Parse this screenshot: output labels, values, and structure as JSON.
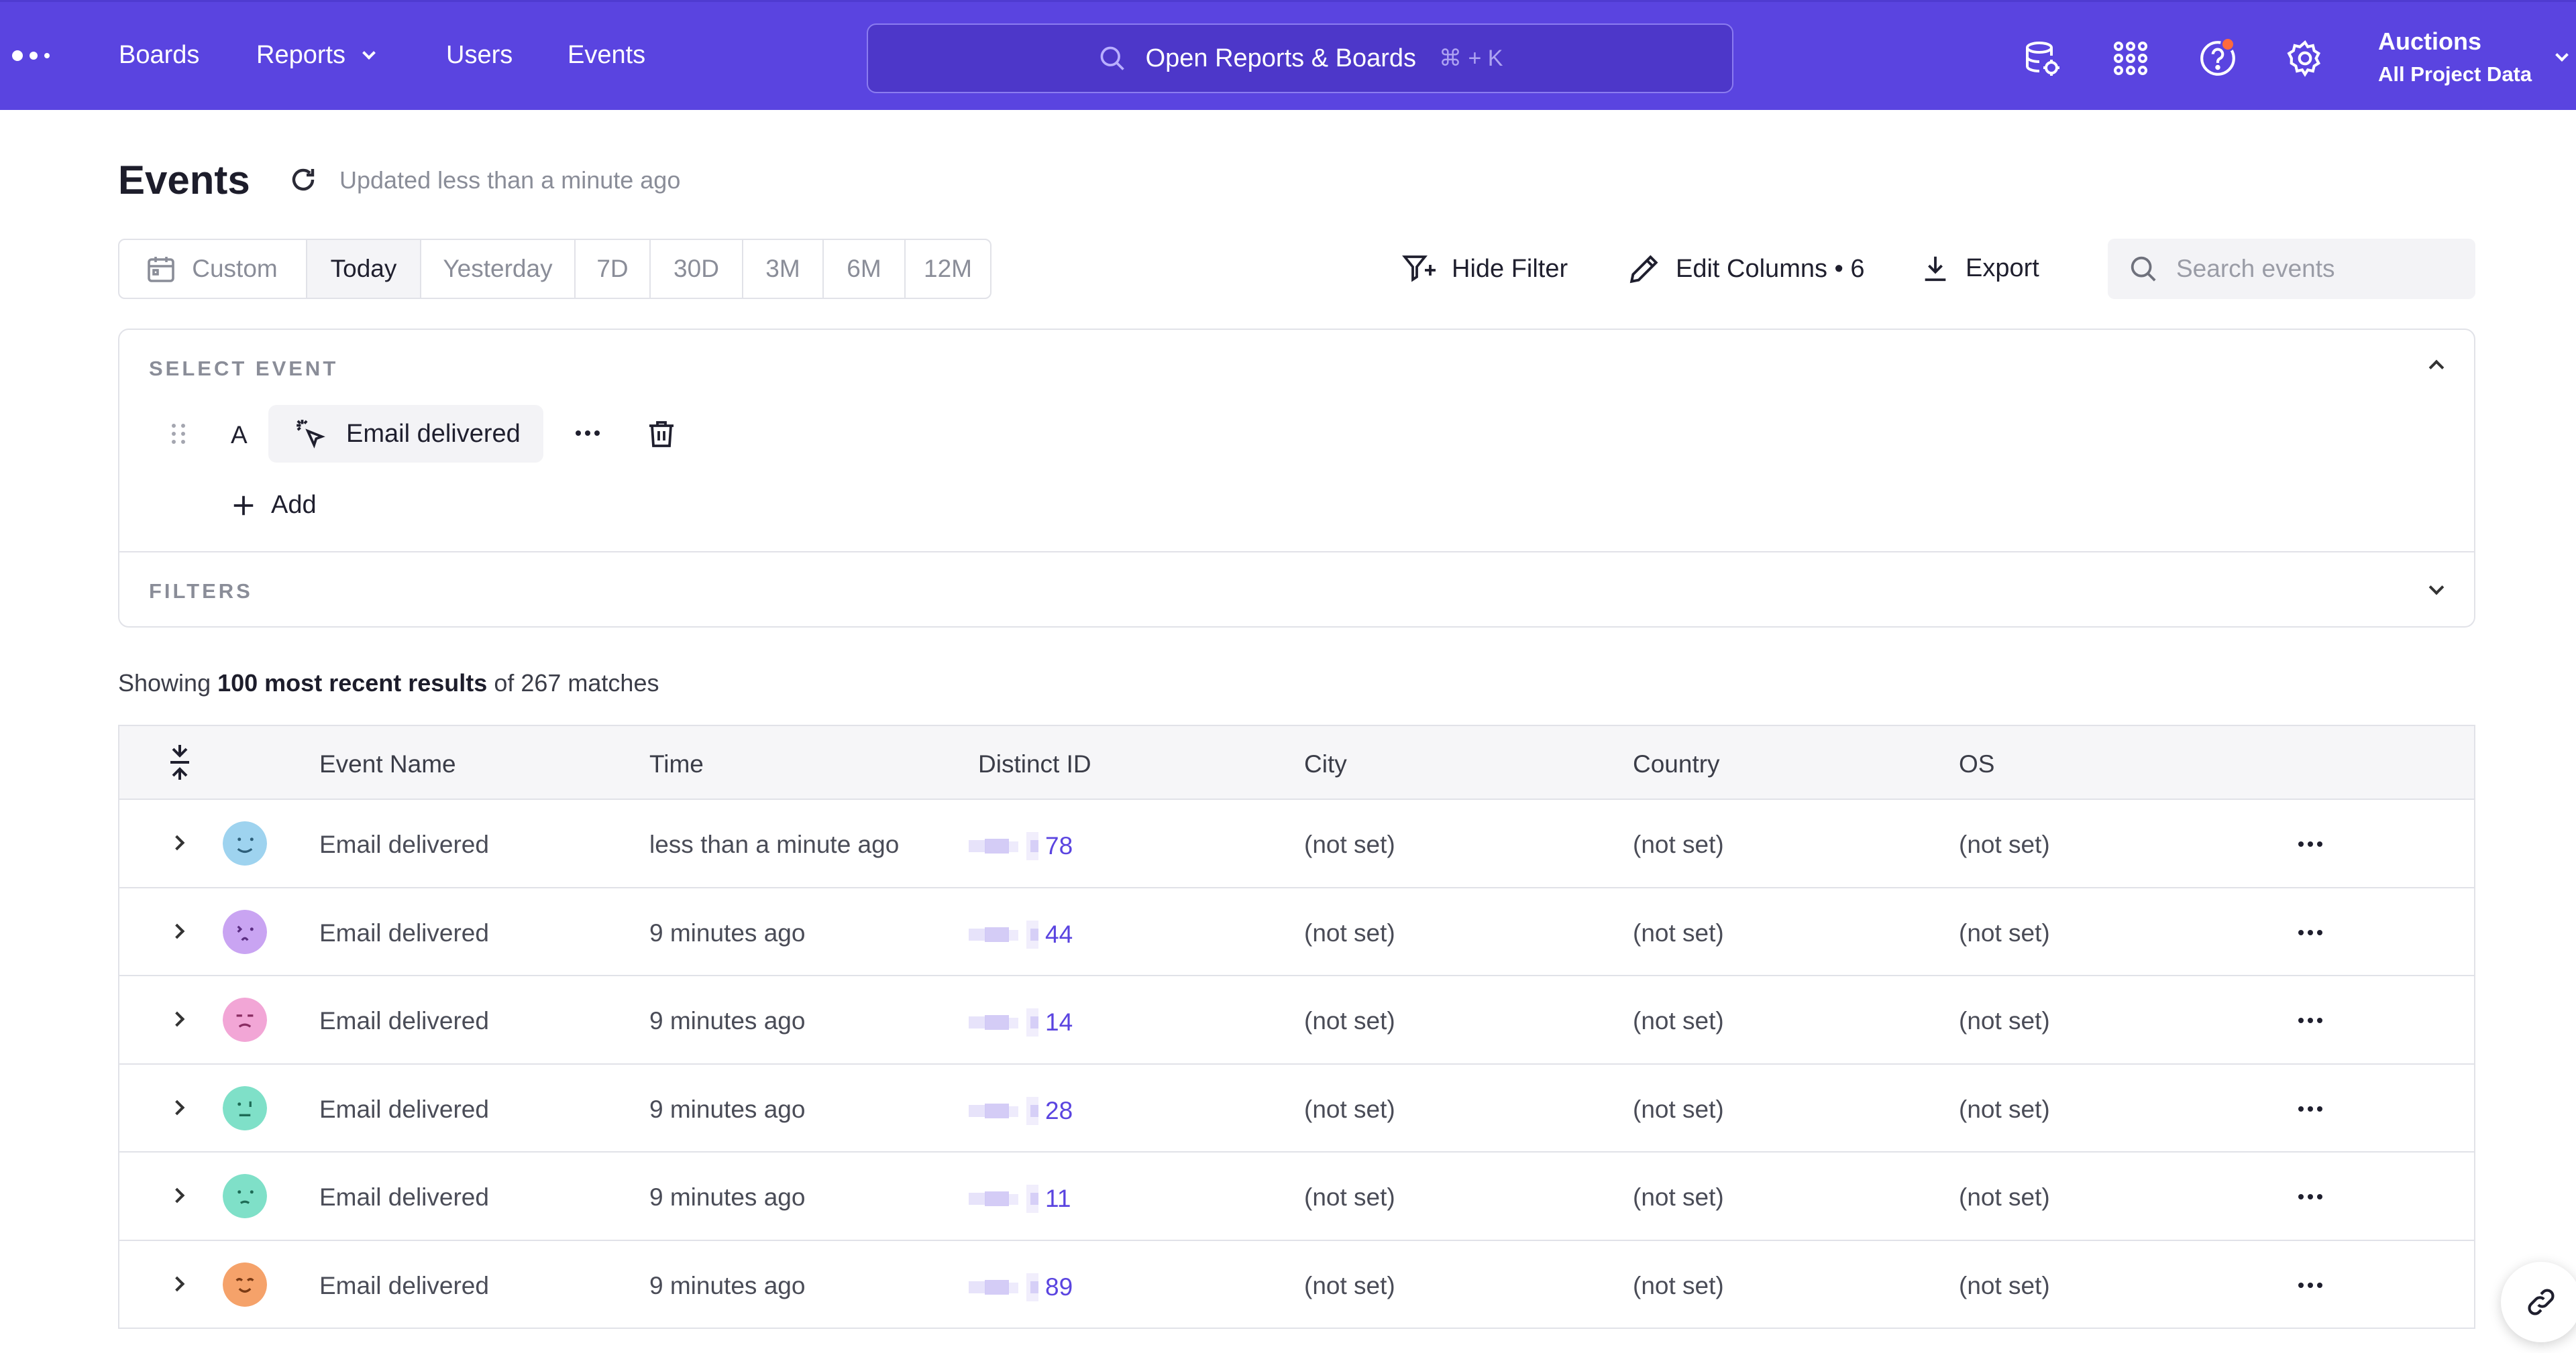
{
  "topnav": {
    "nav_items": [
      "Boards",
      "Reports",
      "Users",
      "Events"
    ],
    "search_label": "Open Reports & Boards",
    "search_shortcut": "⌘ + K",
    "project_name": "Auctions",
    "project_scope": "All Project Data",
    "icons": [
      "data-management-icon",
      "apps-grid-icon",
      "help-icon",
      "settings-icon"
    ]
  },
  "header": {
    "title": "Events",
    "updated": "Updated less than a minute ago"
  },
  "date_range": {
    "options": [
      "Custom",
      "Today",
      "Yesterday",
      "7D",
      "30D",
      "3M",
      "6M",
      "12M"
    ],
    "selected": "Today"
  },
  "toolbar": {
    "hide_filter": "Hide Filter",
    "edit_columns": "Edit Columns • 6",
    "export": "Export",
    "search_placeholder": "Search events"
  },
  "event_select": {
    "section_label": "SELECT EVENT",
    "letter": "A",
    "event_name": "Email delivered",
    "add_label": "Add",
    "filters_label": "FILTERS"
  },
  "summary": {
    "prefix": "Showing",
    "emphasis": "100 most recent results",
    "suffix": "of 267 matches"
  },
  "table": {
    "columns": [
      "Event Name",
      "Time",
      "Distinct ID",
      "City",
      "Country",
      "OS"
    ],
    "rows": [
      {
        "event": "Email delivered",
        "time": "less than a minute ago",
        "id_suffix": "78",
        "city": "(not set)",
        "country": "(not set)",
        "os": "(not set)",
        "avatar_color": "#9ed3ef"
      },
      {
        "event": "Email delivered",
        "time": "9 minutes ago",
        "id_suffix": "44",
        "city": "(not set)",
        "country": "(not set)",
        "os": "(not set)",
        "avatar_color": "#c9a4f2"
      },
      {
        "event": "Email delivered",
        "time": "9 minutes ago",
        "id_suffix": "14",
        "city": "(not set)",
        "country": "(not set)",
        "os": "(not set)",
        "avatar_color": "#f2a6d6"
      },
      {
        "event": "Email delivered",
        "time": "9 minutes ago",
        "id_suffix": "28",
        "city": "(not set)",
        "country": "(not set)",
        "os": "(not set)",
        "avatar_color": "#7fe0c8"
      },
      {
        "event": "Email delivered",
        "time": "9 minutes ago",
        "id_suffix": "11",
        "city": "(not set)",
        "country": "(not set)",
        "os": "(not set)",
        "avatar_color": "#7fe0c8"
      },
      {
        "event": "Email delivered",
        "time": "9 minutes ago",
        "id_suffix": "89",
        "city": "(not set)",
        "country": "(not set)",
        "os": "(not set)",
        "avatar_color": "#f5a26a"
      }
    ]
  },
  "colors": {
    "brand": "#5a44e0",
    "link": "#5a44e0",
    "notification": "#ff6a3d"
  }
}
